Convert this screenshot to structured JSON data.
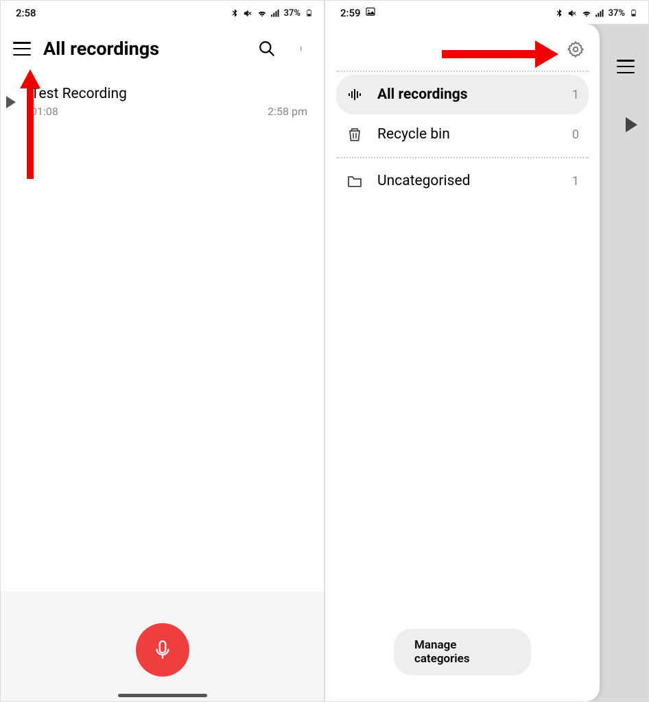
{
  "screen1": {
    "status": {
      "time": "2:58",
      "battery": "37%"
    },
    "header": {
      "title": "All recordings"
    },
    "recording": {
      "title": "Test Recording",
      "duration": "01:08",
      "time": "2:58 pm"
    }
  },
  "screen2": {
    "status": {
      "time": "2:59",
      "battery": "37%"
    },
    "drawer": {
      "items": [
        {
          "label": "All recordings",
          "count": "1"
        },
        {
          "label": "Recycle bin",
          "count": "0"
        },
        {
          "label": "Uncategorised",
          "count": "1"
        }
      ],
      "manage": "Manage categories"
    }
  }
}
